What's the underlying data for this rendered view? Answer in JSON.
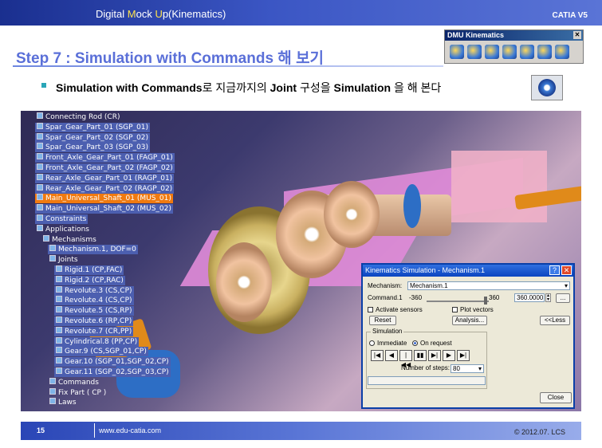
{
  "header": {
    "title_prefix": "Digital ",
    "title_m": "M",
    "title_mid": "ock ",
    "title_u": "U",
    "title_suffix": "p(Kinematics)",
    "product": "CATIA V5"
  },
  "slide": {
    "heading": "Step 7 : Simulation with Commands 해 보기",
    "bullet_bold1": "Simulation with Commands",
    "bullet_mid": "로 지금까지의 ",
    "bullet_bold2": "Joint",
    "bullet_mid2": " 구성을 ",
    "bullet_bold3": "Simulation",
    "bullet_end": " 을 해 본다"
  },
  "toolbar": {
    "title": "DMU Kinematics",
    "close": "✕"
  },
  "tree": [
    {
      "label": "Connecting Rod (CR)",
      "style": ""
    },
    {
      "label": "Spar_Gear_Part_01 (SGP_01)",
      "style": "sel"
    },
    {
      "label": "Spar_Gear_Part_02 (SGP_02)",
      "style": "sel"
    },
    {
      "label": "Spar_Gear_Part_03 (SGP_03)",
      "style": "sel"
    },
    {
      "label": "Front_Axle_Gear_Part_01 (FAGP_01)",
      "style": "sel"
    },
    {
      "label": "Front_Axle_Gear_Part_02 (FAGP_02)",
      "style": "sel"
    },
    {
      "label": "Rear_Axle_Gear_Part_01 (RAGP_01)",
      "style": "sel"
    },
    {
      "label": "Rear_Axle_Gear_Part_02 (RAGP_02)",
      "style": "sel"
    },
    {
      "label": "Main_Universal_Shaft_01 (MUS_01)",
      "style": "hl"
    },
    {
      "label": "Main_Universal_Shaft_02 (MUS_02)",
      "style": "sel"
    },
    {
      "label": "Constraints",
      "style": "sel"
    },
    {
      "label": "Applications",
      "style": ""
    },
    {
      "label": "Mechanisms",
      "style": ""
    },
    {
      "label": "Mechanism.1, DOF=0",
      "style": "sel"
    },
    {
      "label": "Joints",
      "style": ""
    },
    {
      "label": "Rigid.1 (CP,FAC)",
      "style": "sel"
    },
    {
      "label": "Rigid.2 (CP,RAC)",
      "style": "sel"
    },
    {
      "label": "Revolute.3 (CS,CP)",
      "style": "sel"
    },
    {
      "label": "Revolute.4 (CS,CP)",
      "style": "sel"
    },
    {
      "label": "Revolute.5 (CS,RP)",
      "style": "sel"
    },
    {
      "label": "Revolute.6 (RP,CP)",
      "style": "sel"
    },
    {
      "label": "Revolute.7 (CR,PP)",
      "style": "sel"
    },
    {
      "label": "Cylindrical.8 (PP,CP)",
      "style": "sel"
    },
    {
      "label": "Gear.9 (CS,SGP_01,CP)",
      "style": "sel"
    },
    {
      "label": "Gear.10 (SGP_01,SGP_02,CP)",
      "style": "sel"
    },
    {
      "label": "Gear.11 (SGP_02,SGP_03,CP)",
      "style": "sel"
    },
    {
      "label": "Commands",
      "style": ""
    },
    {
      "label": "Fix Part ( CP )",
      "style": ""
    },
    {
      "label": "Laws",
      "style": ""
    }
  ],
  "dialog": {
    "title": "Kinematics Simulation - Mechanism.1",
    "help": "?",
    "close": "✕",
    "mechanism_label": "Mechanism:",
    "mechanism_value": "Mechanism.1",
    "command_label": "Command.1",
    "range_min": "-360",
    "range_max": "360",
    "command_value": "360.0000",
    "more_btn": "...",
    "activate_sensors": "Activate sensors",
    "plot_vectors": "Plot vectors",
    "reset_btn": "Reset",
    "analysis_btn": "Analysis...",
    "less_btn": "<<Less",
    "simulation_group": "Simulation",
    "immediate": "Immediate",
    "on_request": "On request",
    "play_buttons": [
      "|◀",
      "◀",
      "|◀◀",
      "▮▮",
      "▶|",
      "▶",
      "▶|"
    ],
    "steps_label": "Number of steps:",
    "steps_value": "80",
    "close_btn": "Close"
  },
  "footer": {
    "page": "15",
    "url": "www.edu-catia.com",
    "copyright": "© 2012.07. LCS"
  }
}
